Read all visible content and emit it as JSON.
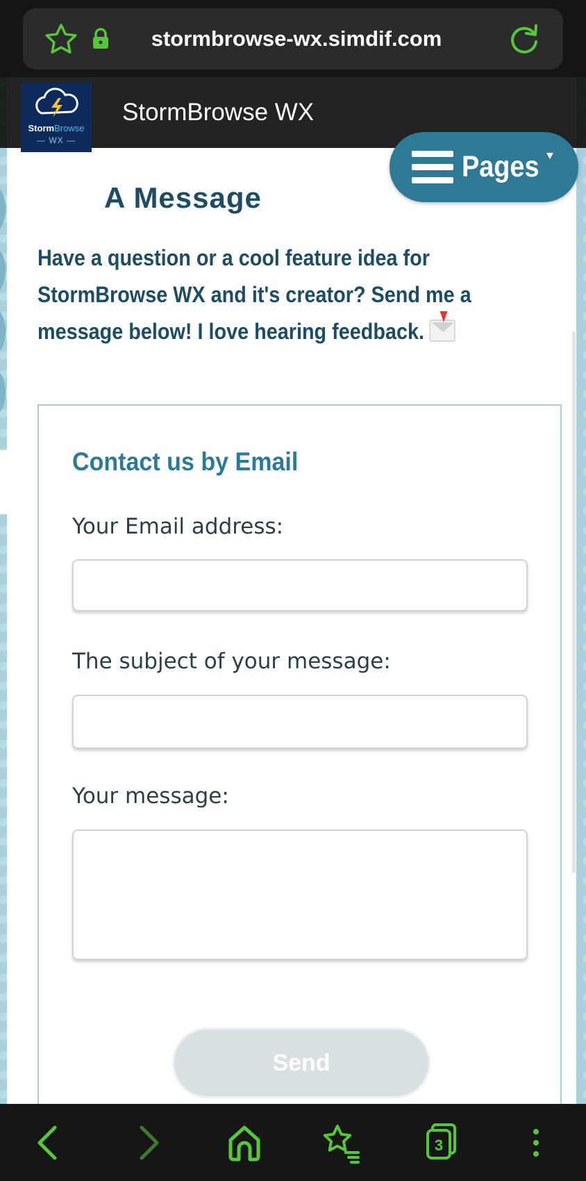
{
  "browser": {
    "url": "stormbrowse-wx.simdif.com",
    "accent_color": "#58c63a",
    "left_icons": [
      "bookmark-star-icon",
      "lock-icon"
    ],
    "right_icon": "reload-icon"
  },
  "site": {
    "logo_text_dark": "Storm",
    "logo_text_accent": "Browse",
    "logo_subtext": "— WX —",
    "title": "StormBrowse WX",
    "partial_heading": "A Message",
    "pages_button_label": "Pages",
    "intro_text": "Have a question or a cool feature idea for StormBrowse WX and it's creator? Send me a message below! I love hearing feedback.",
    "intro_emoji": "incoming-envelope-icon",
    "heading_color": "#1e4c63",
    "brand_color": "#2e7a96"
  },
  "form": {
    "title": "Contact us by Email",
    "email_label": "Your Email address:",
    "email_value": "",
    "subject_label": "The subject of your message:",
    "subject_value": "",
    "message_label": "Your message:",
    "message_value": "",
    "send_label": "Send",
    "send_state": "disabled"
  },
  "bottom_nav": {
    "items": [
      "back-icon",
      "forward-icon",
      "home-icon",
      "bookmarks-icon",
      "tabs-icon",
      "menu-icon"
    ],
    "tab_count": "3"
  }
}
